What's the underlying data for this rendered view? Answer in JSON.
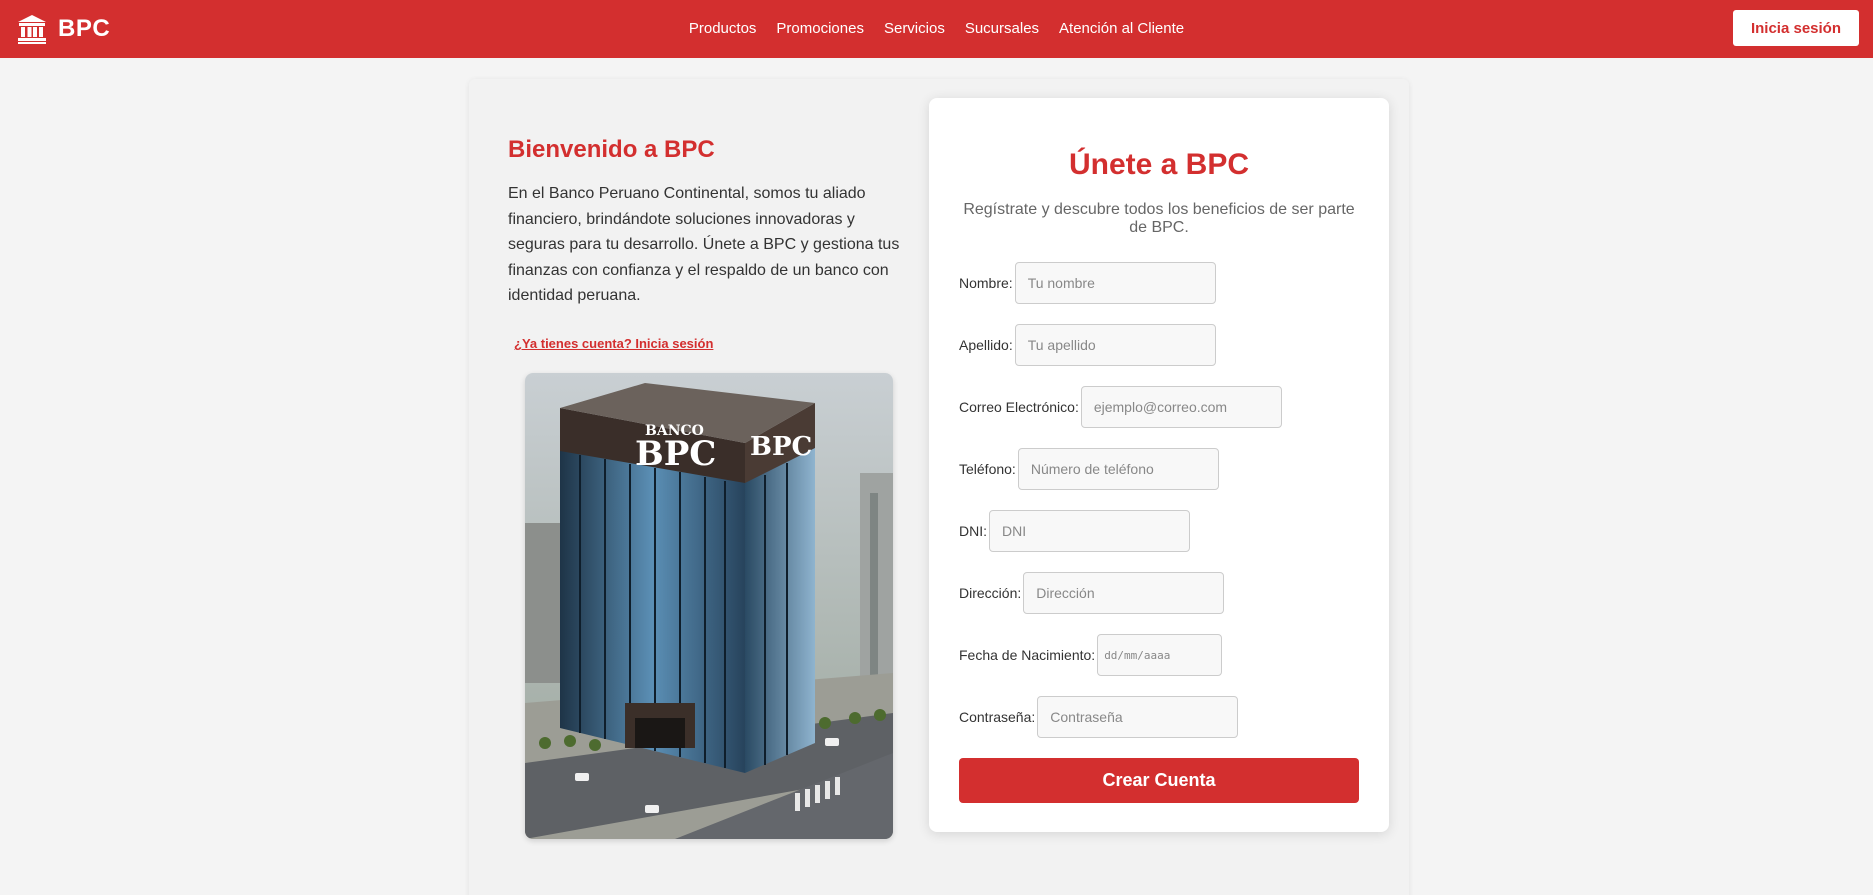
{
  "brand": {
    "name": "BPC",
    "icon": "bank-icon",
    "color": "#d32f2f"
  },
  "nav": {
    "items": [
      {
        "label": "Productos"
      },
      {
        "label": "Promociones"
      },
      {
        "label": "Servicios"
      },
      {
        "label": "Sucursales"
      },
      {
        "label": "Atención al Cliente"
      }
    ],
    "login_label": "Inicia sesión"
  },
  "welcome": {
    "title": "Bienvenido a BPC",
    "text": "En el Banco Peruano Continental, somos tu aliado financiero, brindándote soluciones innovadoras y seguras para tu desarrollo. Únete a BPC y gestiona tus finanzas con confianza y el respaldo de un banco con identidad peruana.",
    "have_account_link": "¿Ya tienes cuenta? Inicia sesión",
    "image": {
      "sign_small": "BANCO",
      "sign_main": "BPC",
      "sign_side": "BPC"
    }
  },
  "form": {
    "title": "Únete a BPC",
    "subtitle": "Regístrate y descubre todos los beneficios de ser parte de BPC.",
    "fields": [
      {
        "label": "Nombre:",
        "placeholder": "Tu nombre",
        "value": ""
      },
      {
        "label": "Apellido:",
        "placeholder": "Tu apellido",
        "value": ""
      },
      {
        "label": "Correo Electrónico:",
        "placeholder": "ejemplo@correo.com",
        "value": ""
      },
      {
        "label": "Teléfono:",
        "placeholder": "Número de teléfono",
        "value": ""
      },
      {
        "label": "DNI:",
        "placeholder": "DNI",
        "value": ""
      },
      {
        "label": "Dirección:",
        "placeholder": "Dirección",
        "value": ""
      },
      {
        "label": "Fecha de Nacimiento:",
        "placeholder": "dd/mm/aaaa",
        "value": ""
      },
      {
        "label": "Contraseña:",
        "placeholder": "Contraseña",
        "value": ""
      }
    ],
    "submit_label": "Crear Cuenta"
  }
}
